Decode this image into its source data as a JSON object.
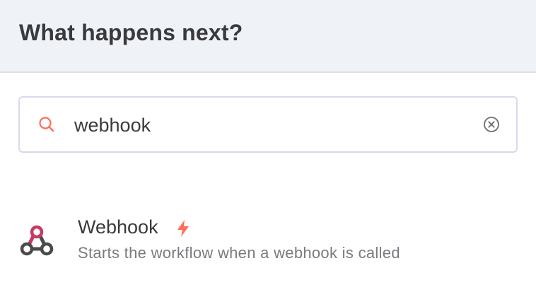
{
  "header": {
    "title": "What happens next?"
  },
  "search": {
    "value": "webhook",
    "icon": "search-icon",
    "clear_icon": "clear-circle-icon"
  },
  "results": [
    {
      "name": "Webhook",
      "description": "Starts the workflow when a webhook is called",
      "icon": "webhook-icon",
      "badge_icon": "lightning-bolt-icon"
    }
  ],
  "colors": {
    "header_bg": "#eff2f7",
    "accent": "#ff6d5a",
    "webhook_pink": "#c73a63",
    "webhook_dark": "#4a4a4a",
    "search_border": "#dad7ef",
    "muted_text": "#7a7a80"
  }
}
